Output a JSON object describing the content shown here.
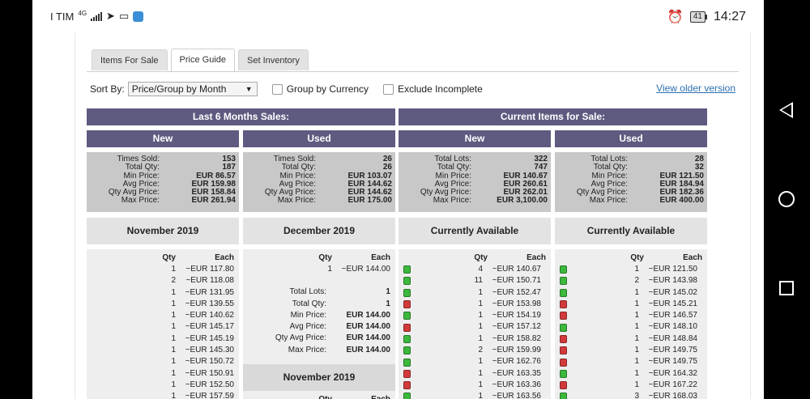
{
  "status": {
    "carrier": "I TIM",
    "net": "4G",
    "battery": "41",
    "time": "14:27"
  },
  "tabs": [
    "Items For Sale",
    "Price Guide",
    "Set Inventory"
  ],
  "controls": {
    "sort_label": "Sort By:",
    "sort_value": "Price/Group by Month",
    "group_currency": "Group by Currency",
    "exclude_incomplete": "Exclude Incomplete",
    "older_link": "View older version"
  },
  "sections": {
    "last6": "Last 6 Months Sales:",
    "current": "Current Items for Sale:"
  },
  "cols": [
    "New",
    "Used",
    "New",
    "Used"
  ],
  "stats": [
    {
      "labels": [
        "Times Sold:",
        "Total Qty:",
        "Min Price:",
        "Avg Price:",
        "Qty Avg Price:",
        "Max Price:"
      ],
      "values": [
        "153",
        "187",
        "EUR 86.57",
        "EUR 159.98",
        "EUR 158.84",
        "EUR 261.94"
      ]
    },
    {
      "labels": [
        "Times Sold:",
        "Total Qty:",
        "Min Price:",
        "Avg Price:",
        "Qty Avg Price:",
        "Max Price:"
      ],
      "values": [
        "26",
        "26",
        "EUR 103.07",
        "EUR 144.62",
        "EUR 144.62",
        "EUR 175.00"
      ]
    },
    {
      "labels": [
        "Total Lots:",
        "Total Qty:",
        "Min Price:",
        "Avg Price:",
        "Qty Avg Price:",
        "Max Price:"
      ],
      "values": [
        "322",
        "747",
        "EUR 140.67",
        "EUR 260.61",
        "EUR 262.01",
        "EUR 3,100.00"
      ]
    },
    {
      "labels": [
        "Total Lots:",
        "Total Qty:",
        "Min Price:",
        "Avg Price:",
        "Qty Avg Price:",
        "Max Price:"
      ],
      "values": [
        "28",
        "32",
        "EUR 121.50",
        "EUR 184.94",
        "EUR 182.36",
        "EUR 400.00"
      ]
    }
  ],
  "months": [
    "November 2019",
    "December 2019",
    "Currently Available",
    "Currently Available"
  ],
  "list_headers": {
    "qty": "Qty",
    "each": "Each"
  },
  "col1_rows": [
    {
      "q": "1",
      "e": "~EUR 117.80"
    },
    {
      "q": "2",
      "e": "~EUR 118.08"
    },
    {
      "q": "1",
      "e": "~EUR 131.95"
    },
    {
      "q": "1",
      "e": "~EUR 139.55"
    },
    {
      "q": "1",
      "e": "~EUR 140.62"
    },
    {
      "q": "1",
      "e": "~EUR 145.17"
    },
    {
      "q": "1",
      "e": "~EUR 145.19"
    },
    {
      "q": "1",
      "e": "~EUR 145.30"
    },
    {
      "q": "1",
      "e": "~EUR 150.72"
    },
    {
      "q": "1",
      "e": "~EUR 150.91"
    },
    {
      "q": "1",
      "e": "~EUR 152.50"
    },
    {
      "q": "1",
      "e": "~EUR 157.59"
    }
  ],
  "col2": {
    "rows": [
      {
        "q": "1",
        "e": "~EUR 144.00"
      }
    ],
    "summary": [
      {
        "l": "Total Lots:",
        "v": "1"
      },
      {
        "l": "Total Qty:",
        "v": "1"
      },
      {
        "l": "Min Price:",
        "v": "EUR 144.00"
      },
      {
        "l": "Avg Price:",
        "v": "EUR 144.00"
      },
      {
        "l": "Qty Avg Price:",
        "v": "EUR 144.00"
      },
      {
        "l": "Max Price:",
        "v": "EUR 144.00"
      }
    ],
    "next_month": "November 2019"
  },
  "col3_rows": [
    {
      "g": "green",
      "q": "4",
      "e": "~EUR 140.67"
    },
    {
      "g": "green",
      "q": "11",
      "e": "~EUR 150.71"
    },
    {
      "g": "green",
      "q": "1",
      "e": "~EUR 152.47"
    },
    {
      "g": "red",
      "q": "1",
      "e": "~EUR 153.98"
    },
    {
      "g": "green",
      "q": "1",
      "e": "~EUR 154.19"
    },
    {
      "g": "red",
      "q": "1",
      "e": "~EUR 157.12"
    },
    {
      "g": "green",
      "q": "1",
      "e": "~EUR 158.82"
    },
    {
      "g": "green",
      "q": "2",
      "e": "~EUR 159.99"
    },
    {
      "g": "green",
      "q": "1",
      "e": "~EUR 162.76"
    },
    {
      "g": "red",
      "q": "1",
      "e": "~EUR 163.35"
    },
    {
      "g": "red",
      "q": "1",
      "e": "~EUR 163.36"
    },
    {
      "g": "green",
      "q": "1",
      "e": "~EUR 163.56"
    }
  ],
  "col4_rows": [
    {
      "g": "green",
      "q": "1",
      "e": "~EUR 121.50"
    },
    {
      "g": "green",
      "q": "2",
      "e": "~EUR 143.98"
    },
    {
      "g": "green",
      "q": "1",
      "e": "~EUR 145.02"
    },
    {
      "g": "red",
      "q": "1",
      "e": "~EUR 145.21"
    },
    {
      "g": "red",
      "q": "1",
      "e": "~EUR 146.57"
    },
    {
      "g": "green",
      "q": "1",
      "e": "~EUR 148.10"
    },
    {
      "g": "red",
      "q": "1",
      "e": "~EUR 148.84"
    },
    {
      "g": "red",
      "q": "1",
      "e": "~EUR 149.75"
    },
    {
      "g": "red",
      "q": "1",
      "e": "~EUR 149.75"
    },
    {
      "g": "green",
      "q": "1",
      "e": "~EUR 164.32"
    },
    {
      "g": "red",
      "q": "1",
      "e": "~EUR 167.22"
    },
    {
      "g": "green",
      "q": "3",
      "e": "~EUR 168.03"
    }
  ],
  "colors": {
    "header": "#5e5a80",
    "gem_green": "#3cb83c",
    "gem_red": "#d23a3a"
  }
}
